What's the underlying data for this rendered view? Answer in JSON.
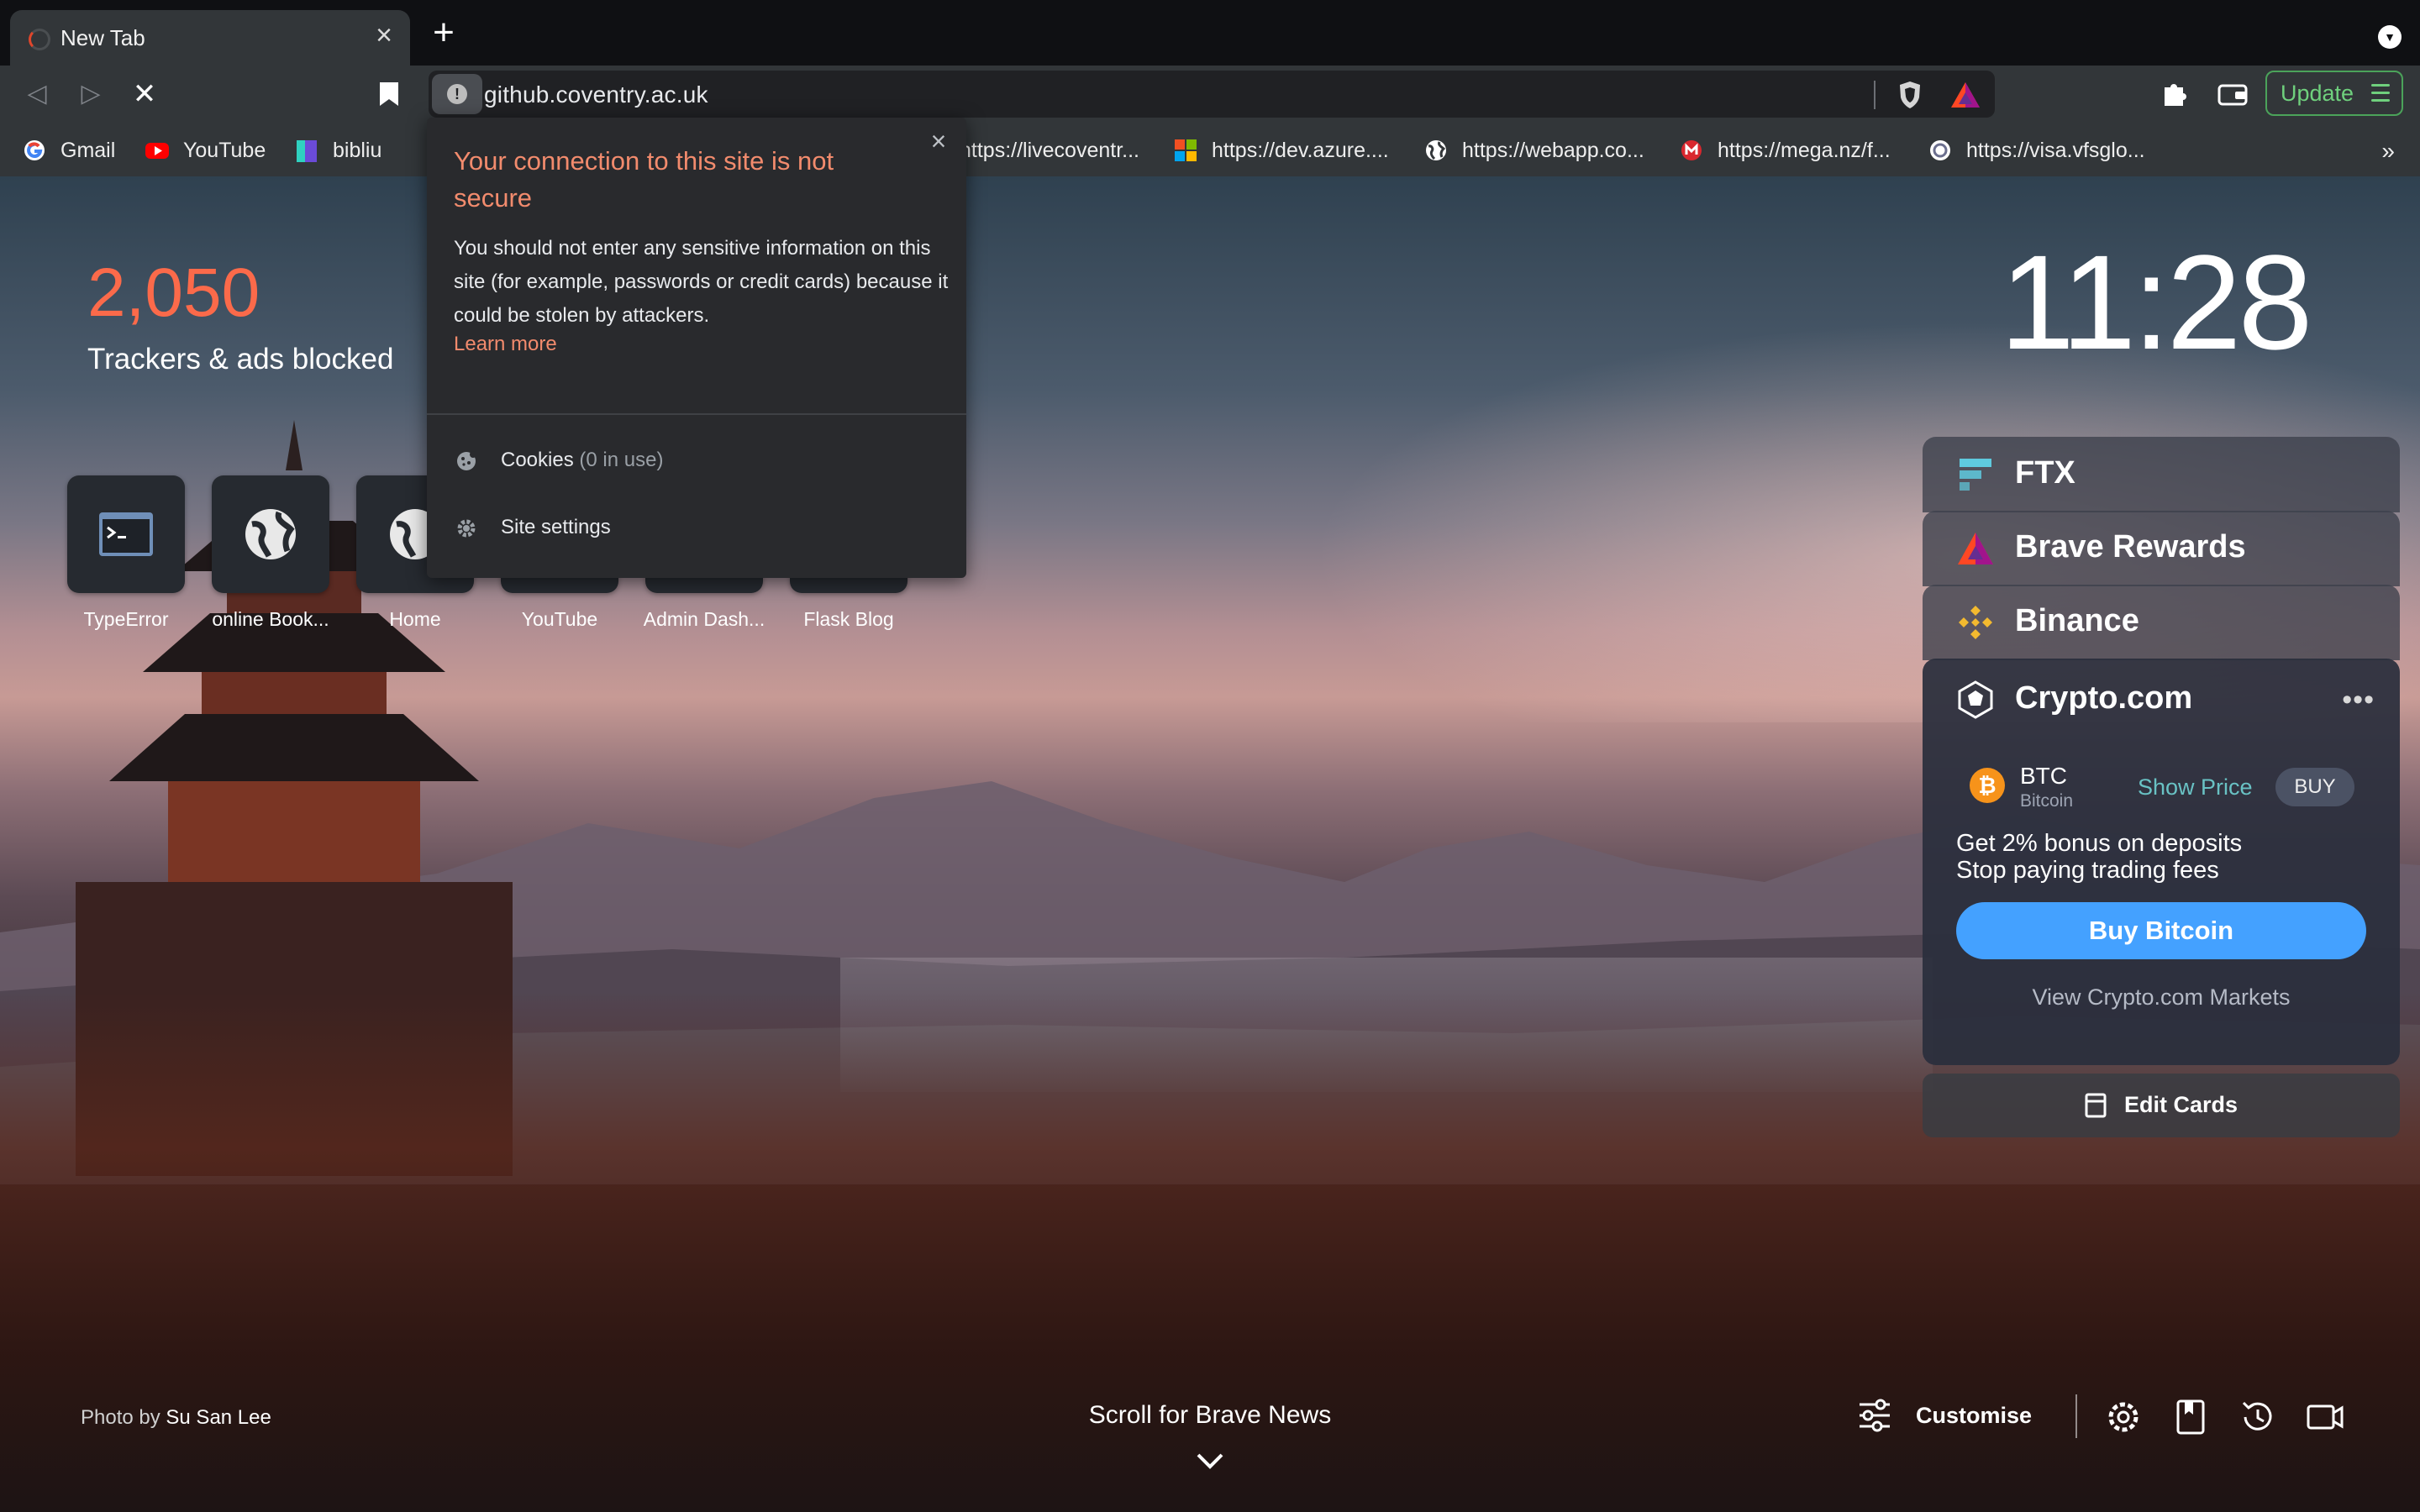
{
  "tab": {
    "title": "New Tab"
  },
  "toolbar": {
    "url": "github.coventry.ac.uk",
    "update_label": "Update"
  },
  "bookmarks": [
    {
      "label": "Gmail",
      "icon": "google-icon"
    },
    {
      "label": "YouTube",
      "icon": "youtube-icon"
    },
    {
      "label": "bibliu",
      "icon": "bibliu-icon"
    },
    {
      "label": "https://livecoventr...",
      "icon": "globe-icon"
    },
    {
      "label": "https://dev.azure....",
      "icon": "microsoft-icon"
    },
    {
      "label": "https://webapp.co...",
      "icon": "globe-icon"
    },
    {
      "label": "https://mega.nz/f...",
      "icon": "mega-icon"
    },
    {
      "label": "https://visa.vfsglo...",
      "icon": "vfs-icon"
    }
  ],
  "bookmarks_more": "»",
  "popup": {
    "title": "Your connection to this site is not secure",
    "body": "You should not enter any sensitive information on this site (for example, passwords or credit cards) because it could be stolen by attackers.",
    "learn_more": "Learn more",
    "cookies_label": "Cookies",
    "cookies_sub": "(0 in use)",
    "site_settings": "Site settings"
  },
  "stats": {
    "count": "2,050",
    "label": "Trackers & ads blocked"
  },
  "clock": "11:28",
  "top_sites": [
    {
      "label": "TypeError",
      "icon": "terminal-icon"
    },
    {
      "label": "online Book...",
      "icon": "globe-icon"
    },
    {
      "label": "Home",
      "icon": "globe-icon"
    },
    {
      "label": "YouTube",
      "icon": "youtube-icon"
    },
    {
      "label": "Admin Dash...",
      "icon": "globe-icon"
    },
    {
      "label": "Flask Blog",
      "icon": "globe-icon"
    }
  ],
  "cards": {
    "ftx": "FTX",
    "brave_rewards": "Brave Rewards",
    "binance": "Binance",
    "crypto_com": {
      "name": "Crypto.com",
      "more": "•••",
      "asset_symbol": "BTC",
      "asset_name": "Bitcoin",
      "show_price": "Show Price",
      "buy": "BUY",
      "promo_line1": "Get 2% bonus on deposits",
      "promo_line2": "Stop paying trading fees",
      "buy_button": "Buy Bitcoin",
      "view_markets": "View Crypto.com Markets"
    },
    "edit_cards": "Edit Cards"
  },
  "footer": {
    "photo_prefix": "Photo by",
    "photo_author": "Su San Lee",
    "scroll_news": "Scroll for Brave News",
    "customise": "Customise"
  },
  "colors": {
    "brave_orange": "#fb6a4a",
    "popup_warning": "#f28b6d",
    "update_green": "#4ba35a",
    "buy_bitcoin_blue": "#44a1ff",
    "show_price_teal": "#69c2c4"
  }
}
